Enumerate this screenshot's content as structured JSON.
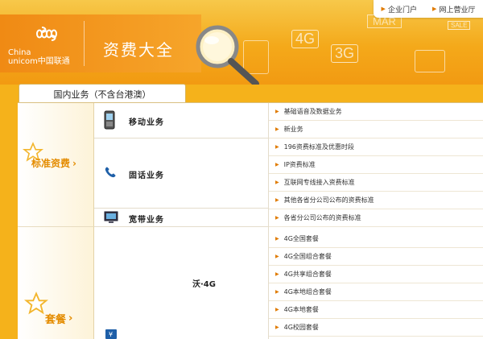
{
  "topbar": {
    "links": [
      "企业门户",
      "网上营业厅"
    ]
  },
  "header": {
    "logo_en_line1": "China",
    "logo_en_line2": "unicom中国联通",
    "title": "资费大全",
    "deco": {
      "t1": "4G",
      "t2": "3G",
      "t3": "MAR",
      "t4": "SALE"
    }
  },
  "tab": {
    "label": "国内业务（不含台港澳）"
  },
  "categories": [
    {
      "label": "标准资费",
      "arrow": "›"
    },
    {
      "label": "套餐",
      "arrow": "›"
    }
  ],
  "services": {
    "mobile": "移动业务",
    "fixed": "固话业务",
    "broadband": "宽带业务",
    "wo4g": "沃·4G"
  },
  "items": {
    "mobile": [
      "基础语音及数据业务",
      "新业务"
    ],
    "fixed": [
      "196资费标准及优惠时段",
      "IP资费标准",
      "互联网专线接入资费标准",
      "其他各省分公司公布的资费标准"
    ],
    "broadband": [
      "各省分公司公布的资费标准"
    ],
    "wo4g": [
      "4G全国套餐",
      "4G全国组合套餐",
      "4G共享组合套餐",
      "4G本地组合套餐",
      "4G本地套餐",
      "4G校园套餐"
    ]
  },
  "colors": {
    "accent": "#e48c00",
    "orange_bg": "#f5b21b",
    "arrow": "#e07a00"
  }
}
